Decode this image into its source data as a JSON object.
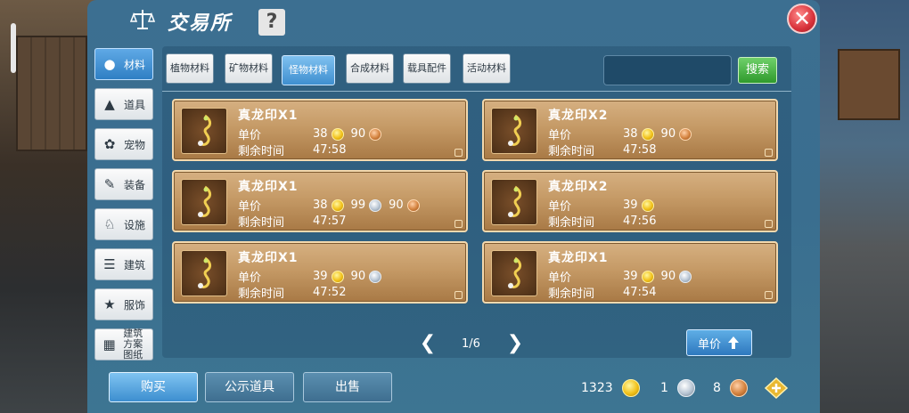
{
  "window": {
    "title": "交易所",
    "help_label": "?",
    "close_label": "✕"
  },
  "sidebar": {
    "items": [
      {
        "label": "材料",
        "icon": "materials-icon",
        "active": true
      },
      {
        "label": "道具",
        "icon": "item-icon",
        "active": false
      },
      {
        "label": "宠物",
        "icon": "pet-paw-icon",
        "active": false
      },
      {
        "label": "装备",
        "icon": "equipment-icon",
        "active": false
      },
      {
        "label": "设施",
        "icon": "facility-icon",
        "active": false
      },
      {
        "label": "建筑",
        "icon": "building-icon",
        "active": false
      },
      {
        "label": "服饰",
        "icon": "clothing-icon",
        "active": false
      },
      {
        "label": "建筑方案图纸",
        "icon": "blueprint-icon",
        "active": false
      }
    ]
  },
  "tabs": [
    {
      "label": "植物材料",
      "active": false
    },
    {
      "label": "矿物材料",
      "active": false
    },
    {
      "label": "怪物材料",
      "active": true
    },
    {
      "label": "合成材料",
      "active": false
    },
    {
      "label": "载具配件",
      "active": false
    },
    {
      "label": "活动材料",
      "active": false
    }
  ],
  "search": {
    "value": "",
    "button_label": "搜索"
  },
  "labels": {
    "unit_price": "单价",
    "remaining_time": "剩余时间"
  },
  "listings": [
    {
      "name": "真龙印X1",
      "price": [
        {
          "v": "38",
          "c": "gold"
        },
        {
          "v": "90",
          "c": "copper"
        }
      ],
      "time": "47:58"
    },
    {
      "name": "真龙印X2",
      "price": [
        {
          "v": "38",
          "c": "gold"
        },
        {
          "v": "90",
          "c": "copper"
        }
      ],
      "time": "47:58"
    },
    {
      "name": "真龙印X1",
      "price": [
        {
          "v": "38",
          "c": "gold"
        },
        {
          "v": "99",
          "c": "silver"
        },
        {
          "v": "90",
          "c": "copper"
        }
      ],
      "time": "47:57"
    },
    {
      "name": "真龙印X2",
      "price": [
        {
          "v": "39",
          "c": "gold"
        }
      ],
      "time": "47:56"
    },
    {
      "name": "真龙印X1",
      "price": [
        {
          "v": "39",
          "c": "gold"
        },
        {
          "v": "90",
          "c": "silver"
        }
      ],
      "time": "47:52"
    },
    {
      "name": "真龙印X1",
      "price": [
        {
          "v": "39",
          "c": "gold"
        },
        {
          "v": "90",
          "c": "silver"
        }
      ],
      "time": "47:54"
    }
  ],
  "pager": {
    "text": "1/6",
    "prev": "❮",
    "next": "❯"
  },
  "sort_button": {
    "label": "单价"
  },
  "bottom": {
    "buy_label": "购买",
    "public_label": "公示道具",
    "sell_label": "出售",
    "gold": "1323",
    "silver": "1",
    "copper": "8"
  }
}
